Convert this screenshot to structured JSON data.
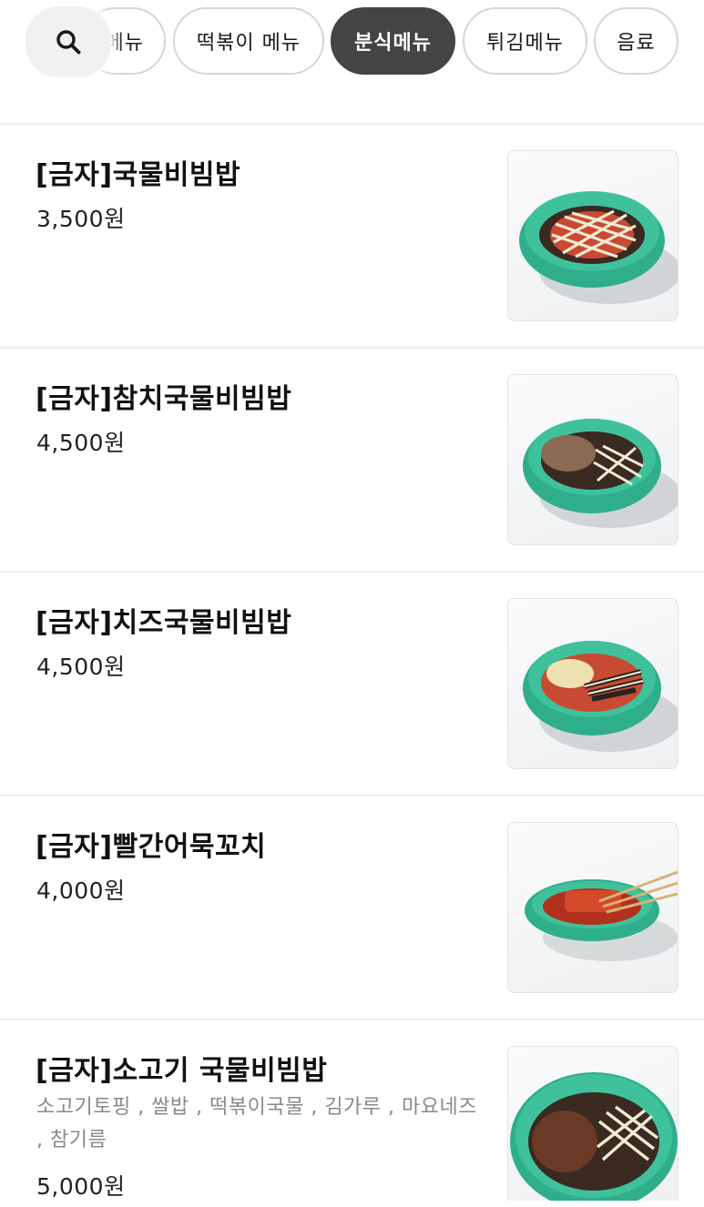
{
  "categories": {
    "tabs": [
      {
        "label": "메뉴"
      },
      {
        "label": "떡볶이 메뉴"
      },
      {
        "label": "분식메뉴"
      },
      {
        "label": "튀김메뉴"
      },
      {
        "label": "음료"
      }
    ],
    "active_index": 2,
    "search_icon": "search-icon"
  },
  "menu": {
    "items": [
      {
        "name": "[금자]국물비빔밥",
        "price": "3,500원",
        "image": "bibimbap-bowl"
      },
      {
        "name": "[금자]참치국물비빔밥",
        "price": "4,500원",
        "image": "tuna-bibimbap-bowl"
      },
      {
        "name": "[금자]치즈국물비빔밥",
        "price": "4,500원",
        "image": "cheese-bibimbap-bowl"
      },
      {
        "name": "[금자]빨간어묵꼬치",
        "price": "4,000원",
        "image": "fishcake-skewer-plate"
      },
      {
        "name": "[금자]소고기 국물비빔밥",
        "description": "소고기토핑 , 쌀밥 , 떡볶이국물 , 김가루 , 마요네즈 , 참기름",
        "price": "5,000원",
        "image": "beef-bibimbap-bowl"
      }
    ]
  },
  "colors": {
    "active_chip": "#444444",
    "chip_border": "#d6d6d6",
    "bowl": "#2fae8c",
    "divider": "#ededed"
  }
}
